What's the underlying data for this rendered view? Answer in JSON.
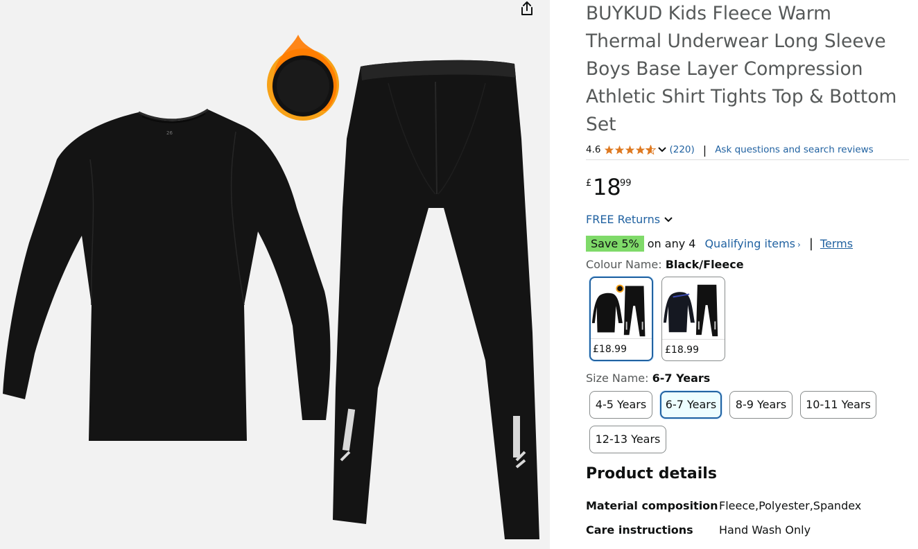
{
  "product": {
    "title": "BUYKUD Kids Fleece Warm Thermal Underwear Long Sleeve Boys Base Layer Compression Athletic Shirt Tights Top & Bottom Set",
    "rating": "4.6",
    "rating_count": "(220)",
    "ask_link": "Ask questions and search reviews",
    "price": {
      "symbol": "£",
      "whole": "18",
      "fraction": "99"
    },
    "free_returns": "FREE Returns",
    "save": {
      "badge": "Save 5%",
      "text": "on any 4",
      "qualifying": "Qualifying items",
      "terms": "Terms"
    }
  },
  "colour": {
    "label": "Colour Name:",
    "selected": "Black/Fleece",
    "options": [
      {
        "price": "£18.99"
      },
      {
        "price": "£18.99"
      }
    ]
  },
  "size": {
    "label": "Size Name:",
    "selected": "6-7 Years",
    "options": [
      "4-5 Years",
      "6-7 Years",
      "8-9 Years",
      "10-11 Years",
      "12-13 Years"
    ]
  },
  "details": {
    "heading": "Product details",
    "rows": [
      {
        "key": "Material composition",
        "value": "Fleece,Polyester,Spandex"
      },
      {
        "key": "Care instructions",
        "value": "Hand Wash Only"
      }
    ]
  },
  "colors": {
    "link": "#2162a1",
    "star": "#de7921",
    "save_badge": "#7fda69",
    "selected_border": "#2162a1"
  }
}
